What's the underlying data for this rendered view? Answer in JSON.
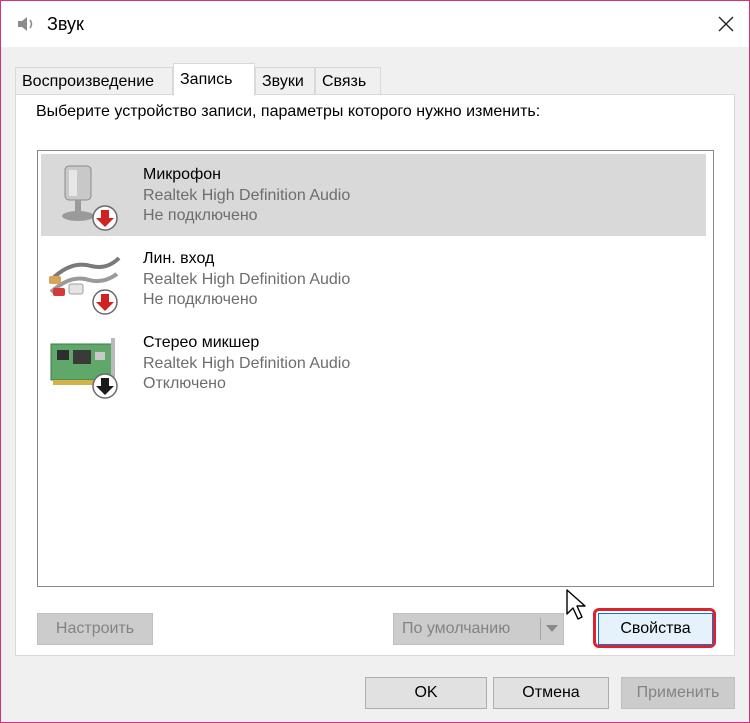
{
  "window": {
    "title": "Звук",
    "close_label": "✕"
  },
  "tabs": [
    {
      "label": "Воспроизведение",
      "active": false
    },
    {
      "label": "Запись",
      "active": true
    },
    {
      "label": "Звуки",
      "active": false
    },
    {
      "label": "Связь",
      "active": false
    }
  ],
  "panel": {
    "instruction": "Выберите устройство записи, параметры которого нужно изменить:",
    "devices": [
      {
        "name": "Микрофон",
        "driver": "Realtek High Definition Audio",
        "status": "Не подключено",
        "icon": "microphone-icon",
        "badge": "red-down-arrow",
        "selected": true
      },
      {
        "name": "Лин. вход",
        "driver": "Realtek High Definition Audio",
        "status": "Не подключено",
        "icon": "line-in-cable-icon",
        "badge": "red-down-arrow",
        "selected": false
      },
      {
        "name": "Стерео микшер",
        "driver": "Realtek High Definition Audio",
        "status": "Отключено",
        "icon": "sound-card-icon",
        "badge": "black-down-arrow",
        "selected": false
      }
    ],
    "buttons": {
      "configure": "Настроить",
      "set_default": "По умолчанию",
      "properties": "Свойства"
    }
  },
  "footer": {
    "ok": "OK",
    "cancel": "Отмена",
    "apply": "Применить"
  },
  "colors": {
    "highlight_border": "#e0202a",
    "selected_row": "#d9d9d9",
    "window_border": "#d1347b"
  }
}
